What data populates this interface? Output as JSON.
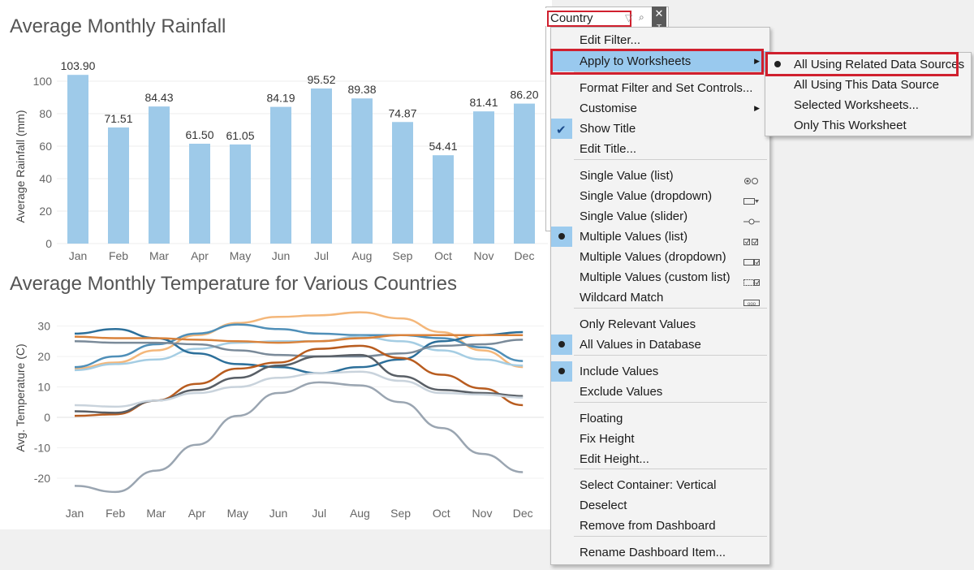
{
  "rainfall": {
    "title": "Average Monthly Rainfall",
    "chart_data": {
      "type": "bar",
      "categories": [
        "Jan",
        "Feb",
        "Mar",
        "Apr",
        "May",
        "Jun",
        "Jul",
        "Aug",
        "Sep",
        "Oct",
        "Nov",
        "Dec"
      ],
      "values": [
        103.9,
        71.51,
        84.43,
        61.5,
        61.05,
        84.19,
        95.52,
        89.38,
        74.87,
        54.41,
        81.41,
        86.2
      ],
      "labels": [
        "103.90",
        "71.51",
        "84.43",
        "61.50",
        "61.05",
        "84.19",
        "95.52",
        "89.38",
        "74.87",
        "54.41",
        "81.41",
        "86.20"
      ],
      "ylabel": "Average Rainfall (mm)",
      "yticks": [
        0,
        20,
        40,
        60,
        80,
        100
      ],
      "ylim": [
        0,
        110
      ],
      "bar_color": "#9ecae9"
    }
  },
  "temperature": {
    "title": "Average Monthly Temperature for Various Countries",
    "chart_data": {
      "type": "line",
      "categories": [
        "Jan",
        "Feb",
        "Mar",
        "Apr",
        "May",
        "Jun",
        "Jul",
        "Aug",
        "Sep",
        "Oct",
        "Nov",
        "Dec"
      ],
      "ylabel": "Avg. Temperature (C)",
      "yticks": [
        -20,
        -10,
        0,
        10,
        20,
        30
      ],
      "ylim": [
        -27,
        33
      ],
      "series": [
        {
          "color": "#f4b77a",
          "values": [
            16,
            18,
            22,
            27,
            31,
            33,
            33.5,
            34.5,
            32.5,
            28,
            22,
            16.5
          ]
        },
        {
          "color": "#4f8fb8",
          "values": [
            16.5,
            20,
            24,
            27.5,
            30.5,
            29,
            27.5,
            27,
            27,
            26,
            23,
            18.5
          ]
        },
        {
          "color": "#a5cde3",
          "values": [
            15.5,
            17.5,
            19,
            22.5,
            24.5,
            25,
            25,
            26.5,
            25,
            22,
            19,
            17
          ]
        },
        {
          "color": "#2c6f9a",
          "values": [
            27.5,
            29,
            26,
            21,
            17.5,
            16.5,
            14.5,
            16.5,
            19,
            25,
            27,
            28
          ]
        },
        {
          "color": "#7a8a99",
          "values": [
            25,
            24.5,
            24.5,
            24,
            22,
            20.5,
            20,
            20,
            21,
            23.5,
            24,
            25.5
          ]
        },
        {
          "color": "#d9823b",
          "values": [
            26.5,
            26,
            26,
            25.5,
            25,
            24.5,
            25,
            26,
            27,
            27,
            27,
            27
          ]
        },
        {
          "color": "#b85c1f",
          "values": [
            0.5,
            1,
            5.5,
            11,
            16,
            18,
            22.5,
            23.5,
            19.5,
            14,
            9.5,
            4
          ]
        },
        {
          "color": "#595f66",
          "values": [
            2,
            1.5,
            5.5,
            9,
            13,
            17,
            20,
            20.5,
            13.5,
            9,
            8,
            7
          ]
        },
        {
          "color": "#c9d3dc",
          "values": [
            4,
            3.5,
            5.5,
            8,
            10,
            13,
            14.5,
            15,
            12,
            8,
            7.5,
            6.5
          ]
        },
        {
          "color": "#9aa5b1",
          "values": [
            -22.5,
            -24.5,
            -17.5,
            -9,
            0.5,
            8,
            11.5,
            10.5,
            5,
            -3.5,
            -12,
            -18
          ]
        }
      ]
    }
  },
  "filter": {
    "title": "Country",
    "funnel_icon": "▽",
    "search_icon": "⌕",
    "close_icon": "✕",
    "pin_icon": "╥"
  },
  "menu": {
    "items": [
      {
        "label": "Edit Filter...",
        "arrow": ""
      },
      {
        "label": "Apply to Worksheets",
        "arrow": "▶"
      },
      {
        "label": "Format Filter and Set Controls...",
        "arrow": ""
      },
      {
        "label": "Customise",
        "arrow": "▶"
      },
      {
        "label": "Show Title",
        "arrow": ""
      },
      {
        "label": "Edit Title...",
        "arrow": ""
      },
      {
        "label": "Single Value (list)",
        "arrow": ""
      },
      {
        "label": "Single Value (dropdown)",
        "arrow": ""
      },
      {
        "label": "Single Value (slider)",
        "arrow": ""
      },
      {
        "label": "Multiple Values (list)",
        "arrow": ""
      },
      {
        "label": "Multiple Values (dropdown)",
        "arrow": ""
      },
      {
        "label": "Multiple Values (custom list)",
        "arrow": ""
      },
      {
        "label": "Wildcard Match",
        "arrow": ""
      },
      {
        "label": "Only Relevant Values",
        "arrow": ""
      },
      {
        "label": "All Values in Database",
        "arrow": ""
      },
      {
        "label": "Include Values",
        "arrow": ""
      },
      {
        "label": "Exclude Values",
        "arrow": ""
      },
      {
        "label": "Floating",
        "arrow": ""
      },
      {
        "label": "Fix Height",
        "arrow": ""
      },
      {
        "label": "Edit Height...",
        "arrow": ""
      },
      {
        "label": "Select Container: Vertical",
        "arrow": ""
      },
      {
        "label": "Deselect",
        "arrow": ""
      },
      {
        "label": "Remove from Dashboard",
        "arrow": ""
      },
      {
        "label": "Rename Dashboard Item...",
        "arrow": ""
      }
    ]
  },
  "submenu": {
    "items": [
      {
        "label": "All Using Related Data Sources",
        "selected": true
      },
      {
        "label": "All Using This Data Source",
        "selected": false
      },
      {
        "label": "Selected Worksheets...",
        "selected": false
      },
      {
        "label": "Only This Worksheet",
        "selected": false
      }
    ]
  },
  "colors": {
    "highlight": "#99c9ee",
    "annotation_red": "#d0202e",
    "menu_bg": "#f3f3f3"
  }
}
